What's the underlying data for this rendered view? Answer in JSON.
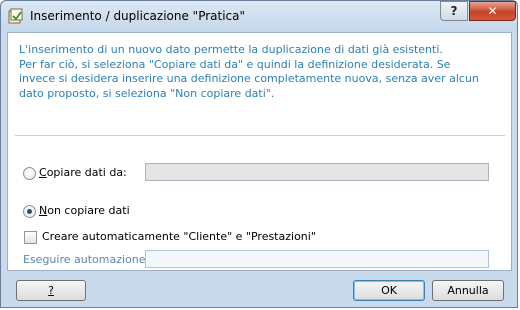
{
  "window": {
    "title": "Inserimento / duplicazione \"Pratica\"",
    "help_glyph": "?",
    "close_glyph": "✕"
  },
  "intro_text": "L'inserimento di un nuovo dato permette la duplicazione di dati già esistenti.\nPer far ciò, si seleziona \"Copiare dati da\" e quindi la definizione desiderata. Se invece si desidera inserire una definizione completamente nuova, senza aver alcun dato proposto, si seleziona \"Non copiare dati\".",
  "options": {
    "copy_label": "Copiare dati da:",
    "copy_selected": false,
    "copy_value": "",
    "nocopy_label": "Non copiare dati",
    "nocopy_selected": true,
    "auto_create_label": "Creare automaticamente \"Cliente\" e \"Prestazioni\"",
    "auto_create_checked": false,
    "automation_label": "Eseguire automazione:",
    "automation_value": ""
  },
  "buttons": {
    "help": "?",
    "ok": "OK",
    "cancel": "Annulla"
  },
  "colors": {
    "intro_text": "#2e7fb4",
    "frame": "#c9daec",
    "close_button": "#c5452b"
  }
}
